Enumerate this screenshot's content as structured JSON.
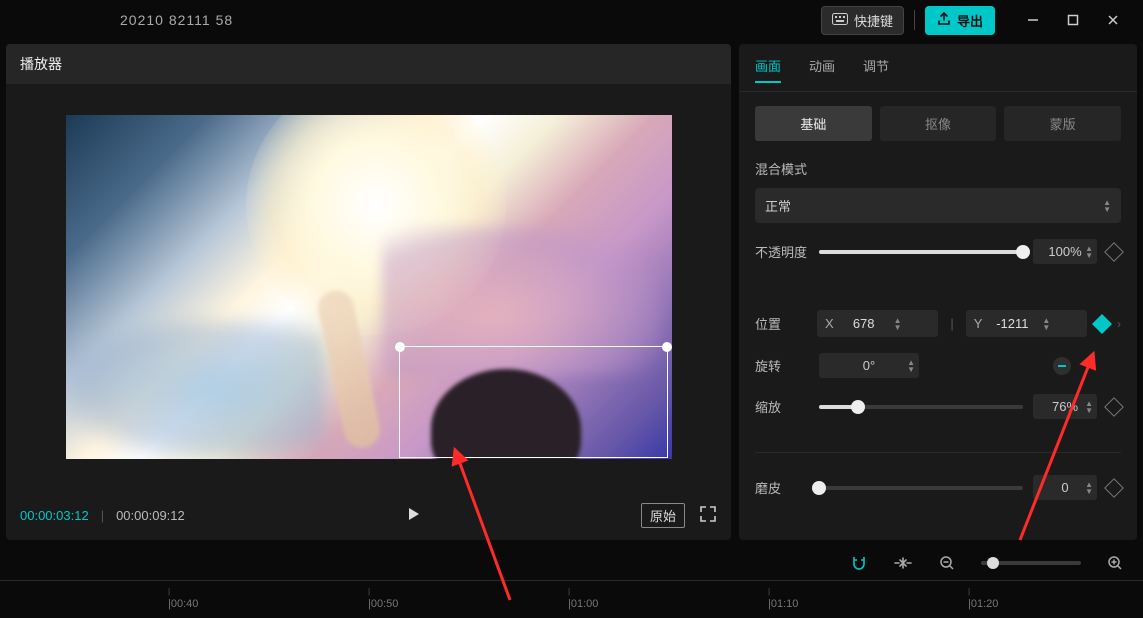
{
  "topbar": {
    "title": "20210 82111 58",
    "shortcut_label": "快捷键",
    "export_label": "导出"
  },
  "player": {
    "header": "播放器",
    "current_time": "00:00:03:12",
    "duration": "00:00:09:12",
    "ratio_chip": "原始"
  },
  "tabs": {
    "t1": "画面",
    "t2": "动画",
    "t3": "调节"
  },
  "subtabs": {
    "s1": "基础",
    "s2": "抠像",
    "s3": "蒙版"
  },
  "props": {
    "blend_label": "混合模式",
    "blend_value": "正常",
    "opacity_label": "不透明度",
    "opacity_value": "100%",
    "position_label": "位置",
    "pos_x_label": "X",
    "pos_x_value": "678",
    "pos_y_label": "Y",
    "pos_y_value": "-1211",
    "rotate_label": "旋转",
    "rotate_value": "0°",
    "scale_label": "缩放",
    "scale_value": "76%",
    "smooth_label": "磨皮",
    "smooth_value": "0"
  },
  "timeline": {
    "ticks": [
      "|00:40",
      "|00:50",
      "|01:00",
      "|01:10",
      "|01:20"
    ]
  }
}
